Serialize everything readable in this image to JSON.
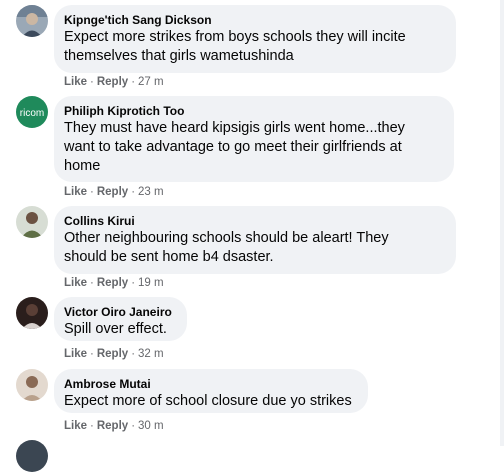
{
  "comments": [
    {
      "author": "Kipnge'tich Sang Dickson",
      "lines": [
        "Expect more strikes from boys schools they will incite",
        "themselves that girls wametushinda"
      ],
      "like": "Like",
      "reply": "Reply",
      "time": "27 m",
      "avatar_colors": [
        "#7c8fa3",
        "#cbb7a3"
      ]
    },
    {
      "author": "Philiph Kiprotich Too",
      "lines": [
        "They must have heard kipsigis girls went home...they",
        "want to take advantage to go meet their girlfriends at",
        "home"
      ],
      "like": "Like",
      "reply": "Reply",
      "time": "23 m",
      "avatar_text": "ricom",
      "avatar_colors": [
        "#1f8a5b",
        "#ffffff"
      ]
    },
    {
      "author": "Collins Kirui",
      "lines": [
        "Other neighbouring schools should be aleart! They",
        "should be sent home b4 dsaster."
      ],
      "like": "Like",
      "reply": "Reply",
      "time": "19 m",
      "avatar_colors": [
        "#c9d3c7",
        "#4d5d3a"
      ]
    },
    {
      "author": "Victor Oiro Janeiro",
      "lines": [
        "Spill over effect."
      ],
      "like": "Like",
      "reply": "Reply",
      "time": "32 m",
      "avatar_colors": [
        "#2a1e1c",
        "#d9d2cf"
      ]
    },
    {
      "author": "Ambrose Mutai",
      "lines": [
        "Expect more of school closure due yo strikes"
      ],
      "like": "Like",
      "reply": "Reply",
      "time": "30 m",
      "avatar_colors": [
        "#d6c9bd",
        "#8a6a55"
      ]
    }
  ]
}
